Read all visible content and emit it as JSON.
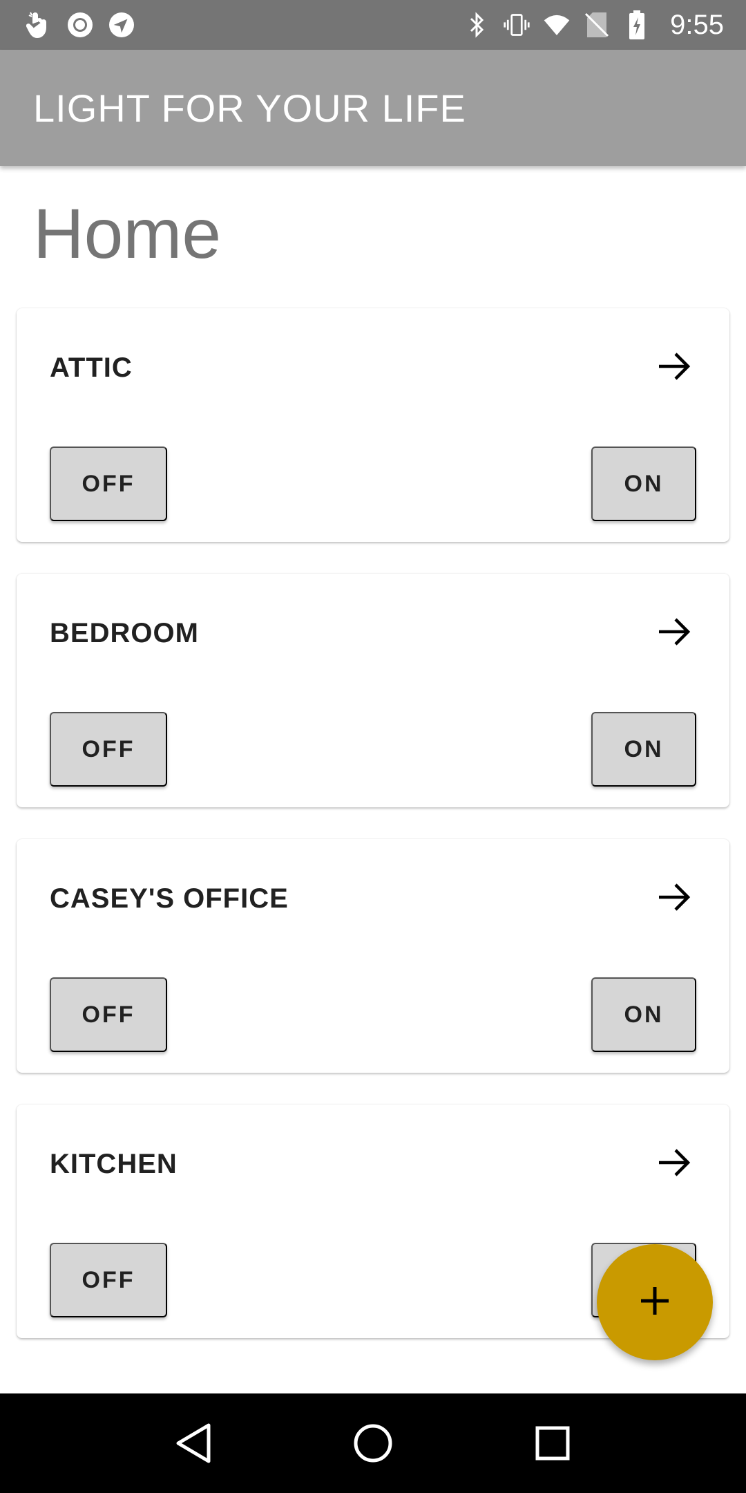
{
  "status_bar": {
    "time": "9:55",
    "left_icons": [
      "touch-gesture-icon",
      "record-icon",
      "navigation-icon"
    ],
    "right_icons": [
      "bluetooth-icon",
      "vibrate-icon",
      "wifi-icon",
      "no-sim-icon",
      "battery-charging-icon"
    ]
  },
  "app_bar": {
    "title": "LIGHT FOR YOUR LIFE"
  },
  "page": {
    "title": "Home"
  },
  "rooms": [
    {
      "name": "ATTIC",
      "off_label": "OFF",
      "on_label": "ON"
    },
    {
      "name": "BEDROOM",
      "off_label": "OFF",
      "on_label": "ON"
    },
    {
      "name": "CASEY'S OFFICE",
      "off_label": "OFF",
      "on_label": "ON"
    },
    {
      "name": "KITCHEN",
      "off_label": "OFF",
      "on_label": "ON"
    }
  ],
  "fab": {
    "icon": "plus-icon",
    "color": "#c99a00"
  },
  "nav_bar": {
    "icons": [
      "back-icon",
      "home-icon",
      "recents-icon"
    ]
  },
  "colors": {
    "status_bar": "#757575",
    "app_bar": "#9e9e9e",
    "button": "#d6d6d6",
    "accent": "#c99a00"
  }
}
